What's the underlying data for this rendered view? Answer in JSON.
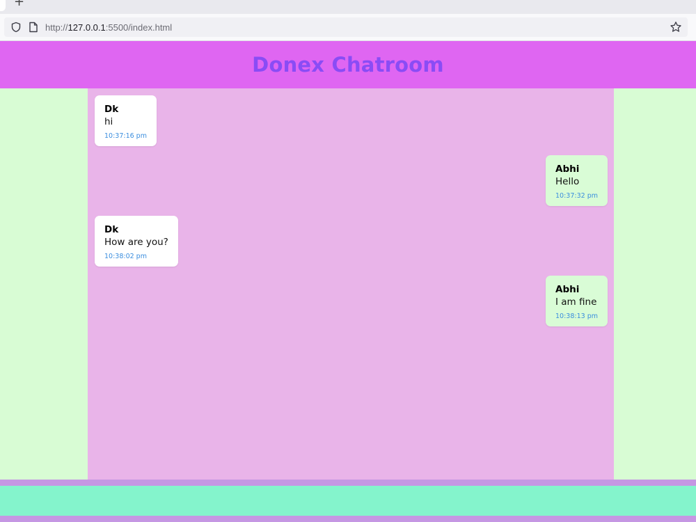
{
  "browser": {
    "url_prefix": "http://",
    "url_host": "127.0.0.1",
    "url_rest": ":5500/index.html",
    "new_tab_label": "+"
  },
  "header": {
    "title": "Donex Chatroom"
  },
  "colors": {
    "header_bg": "#df66f2",
    "title": "#8a4cf5",
    "chat_bg": "#e9b4e9",
    "side_bg": "#d8fcd4",
    "incoming_bubble": "#ffffff",
    "outgoing_bubble": "#d9fcd6",
    "timestamp": "#3a8dde",
    "input_bar": "#84f4cc"
  },
  "messages": [
    {
      "side": "left",
      "name": "Dk",
      "text": "hi",
      "time": "10:37:16 pm"
    },
    {
      "side": "right",
      "name": "Abhi",
      "text": "Hello",
      "time": "10:37:32 pm"
    },
    {
      "side": "left",
      "name": "Dk",
      "text": "How are you?",
      "time": "10:38:02 pm"
    },
    {
      "side": "right",
      "name": "Abhi",
      "text": "I am fine",
      "time": "10:38:13 pm"
    }
  ]
}
